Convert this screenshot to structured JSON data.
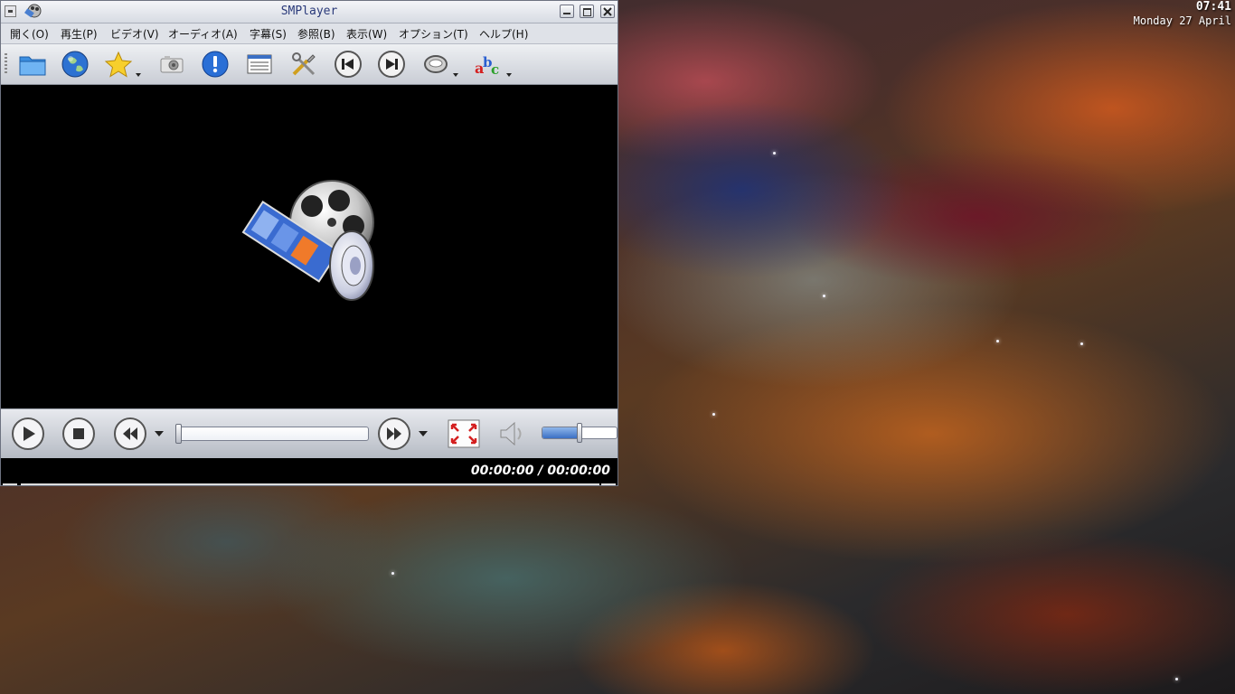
{
  "desktop": {
    "clock_time": "07:41",
    "clock_date": "Monday 27 April"
  },
  "window": {
    "title": "SMPlayer"
  },
  "menubar": {
    "items": [
      {
        "label": "開く(O)"
      },
      {
        "label": "再生(P)"
      },
      {
        "label": "ビデオ(V)"
      },
      {
        "label": "オーディオ(A)"
      },
      {
        "label": "字幕(S)"
      },
      {
        "label": "参照(B)"
      },
      {
        "label": "表示(W)"
      },
      {
        "label": "オプション(T)"
      },
      {
        "label": "ヘルプ(H)"
      }
    ]
  },
  "toolbar": {
    "buttons": [
      {
        "icon": "folder-open-icon"
      },
      {
        "icon": "globe-icon"
      },
      {
        "icon": "favorites-star-icon"
      },
      {
        "icon": "screenshot-camera-icon"
      },
      {
        "icon": "info-icon"
      },
      {
        "icon": "playlist-icon"
      },
      {
        "icon": "preferences-tools-icon"
      },
      {
        "icon": "previous-track-icon"
      },
      {
        "icon": "next-track-icon"
      },
      {
        "icon": "audio-track-icon"
      },
      {
        "icon": "subtitles-icon"
      }
    ]
  },
  "controls": {
    "seek_position": 0.0,
    "volume_level": 0.5
  },
  "status": {
    "timecode": "00:00:00 / 00:00:00"
  },
  "colors": {
    "accent_blue": "#3a6fc4",
    "title_text": "#2a3a7a"
  }
}
